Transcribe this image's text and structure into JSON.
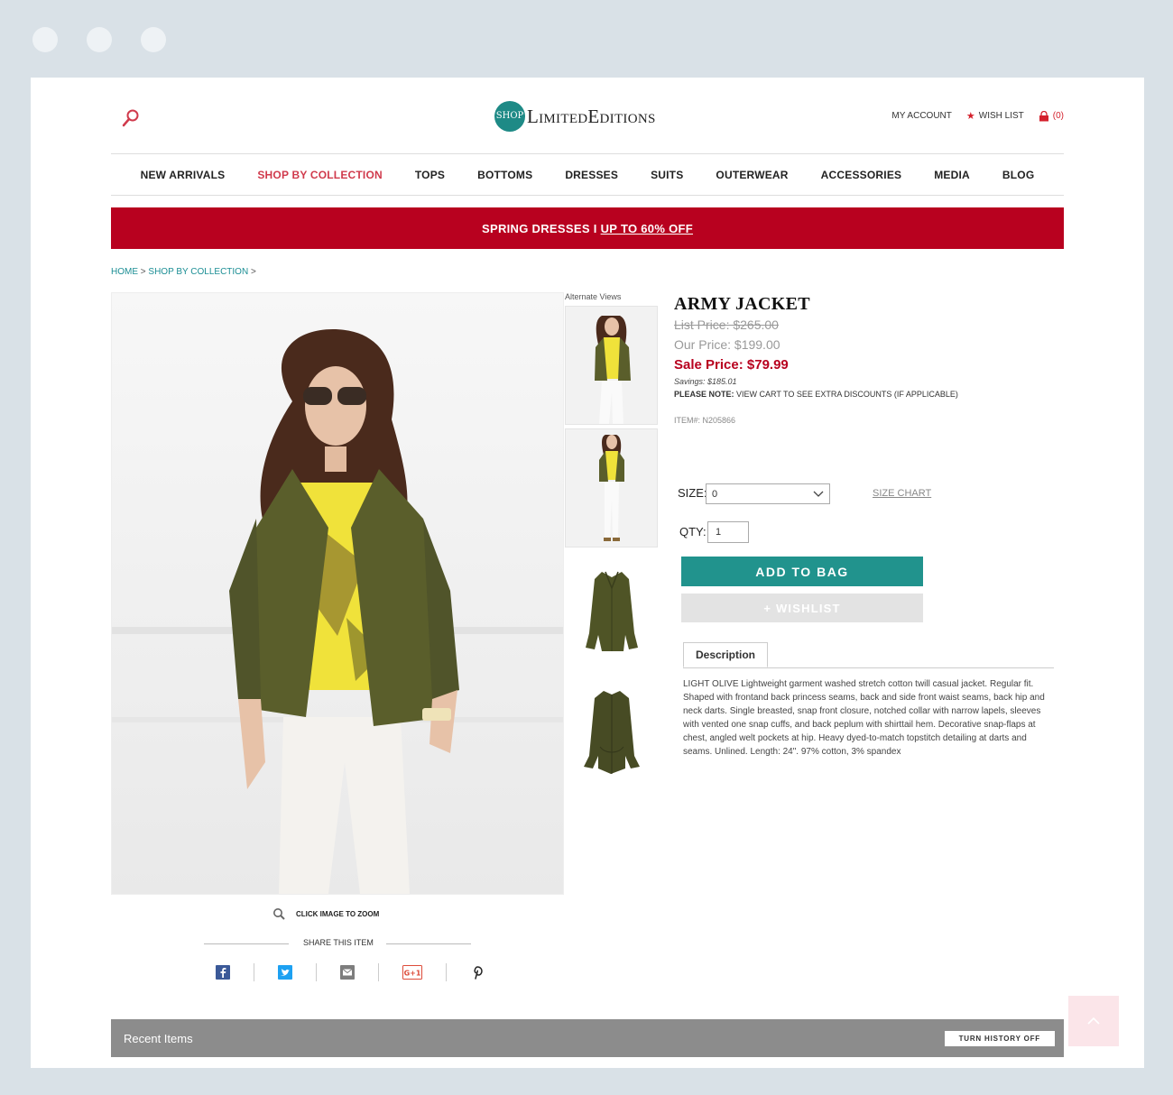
{
  "header": {
    "logo_badge": "SHOP",
    "logo_text": "LimitedEditions",
    "my_account": "MY ACCOUNT",
    "wish_list": "WISH LIST",
    "cart_count": "(0)"
  },
  "nav": {
    "items": [
      "NEW ARRIVALS",
      "SHOP BY COLLECTION",
      "TOPS",
      "BOTTOMS",
      "DRESSES",
      "SUITS",
      "OUTERWEAR",
      "ACCESSORIES",
      "MEDIA",
      "BLOG"
    ],
    "active": "SHOP BY COLLECTION"
  },
  "promo": {
    "text": "SPRING DRESSES I",
    "link": "UP TO 60% OFF"
  },
  "breadcrumb": {
    "home": "HOME",
    "collection": "SHOP BY COLLECTION",
    "separator": ">"
  },
  "gallery": {
    "alt_views_label": "Alternate Views",
    "zoom_label": "CLICK IMAGE TO ZOOM",
    "share_label": "SHARE THIS ITEM"
  },
  "product": {
    "title": "ARMY JACKET",
    "list_price": "List Price: $265.00",
    "our_price": "Our Price: $199.00",
    "sale_price": "Sale Price: $79.99",
    "savings": "Savings: $185.01",
    "note_label": "PLEASE NOTE:",
    "note_text": "VIEW CART TO SEE EXTRA DISCOUNTS (IF APPLICABLE)",
    "item_number": "ITEM#: N205866",
    "size_label": "SIZE:",
    "size_value": "0",
    "size_chart": "SIZE CHART",
    "qty_label": "QTY:",
    "qty_value": "1",
    "add_to_bag": "ADD TO BAG",
    "wishlist": "+ WISHLIST",
    "description_tab": "Description",
    "description": "LIGHT OLIVE Lightweight garment washed stretch cotton twill casual jacket. Regular fit. Shaped with frontand back princess seams, back and side front waist seams, back hip and neck darts. Single breasted, snap front closure, notched collar with narrow lapels, sleeves with vented one snap cuffs, and back peplum with shirttail hem. Decorative snap-flaps at chest, angled welt pockets at hip. Heavy dyed-to-match topstitch detailing at darts and seams. Unlined. Length: 24\". 97% cotton, 3% spandex"
  },
  "recent": {
    "label": "Recent Items",
    "button": "TURN HISTORY OFF"
  },
  "colors": {
    "accent": "#21938d",
    "sale": "#b8011f",
    "promo": "#b8011f",
    "nav_active": "#d03a4c"
  }
}
